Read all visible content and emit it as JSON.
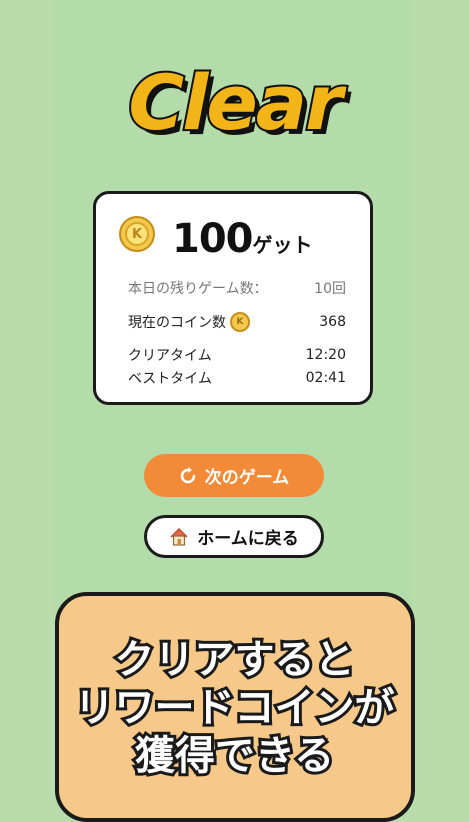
{
  "logo": {
    "text": "Clear"
  },
  "result_card": {
    "reward_amount": "100",
    "reward_unit": "ゲット",
    "remaining_games_label": "本日の残りゲーム数：",
    "remaining_games_value": "10回",
    "current_coins_label": "現在のコイン数",
    "current_coins_value": "368",
    "clear_time_label": "クリアタイム",
    "clear_time_value": "12:20",
    "best_time_label": "ベストタイム",
    "best_time_value": "02:41"
  },
  "buttons": {
    "next_game": "次のゲーム",
    "back_home": "ホームに戻る"
  },
  "promo": {
    "line1": "クリアすると",
    "line2": "リワードコインが",
    "line3": "獲得できる"
  },
  "colors": {
    "background": "#b8dcac",
    "accent_yellow": "#f3b418",
    "next_button": "#f28a38",
    "promo_panel": "#f6c98a"
  },
  "icons": {
    "coin": "coin-icon",
    "replay": "replay-icon",
    "home": "home-icon"
  }
}
